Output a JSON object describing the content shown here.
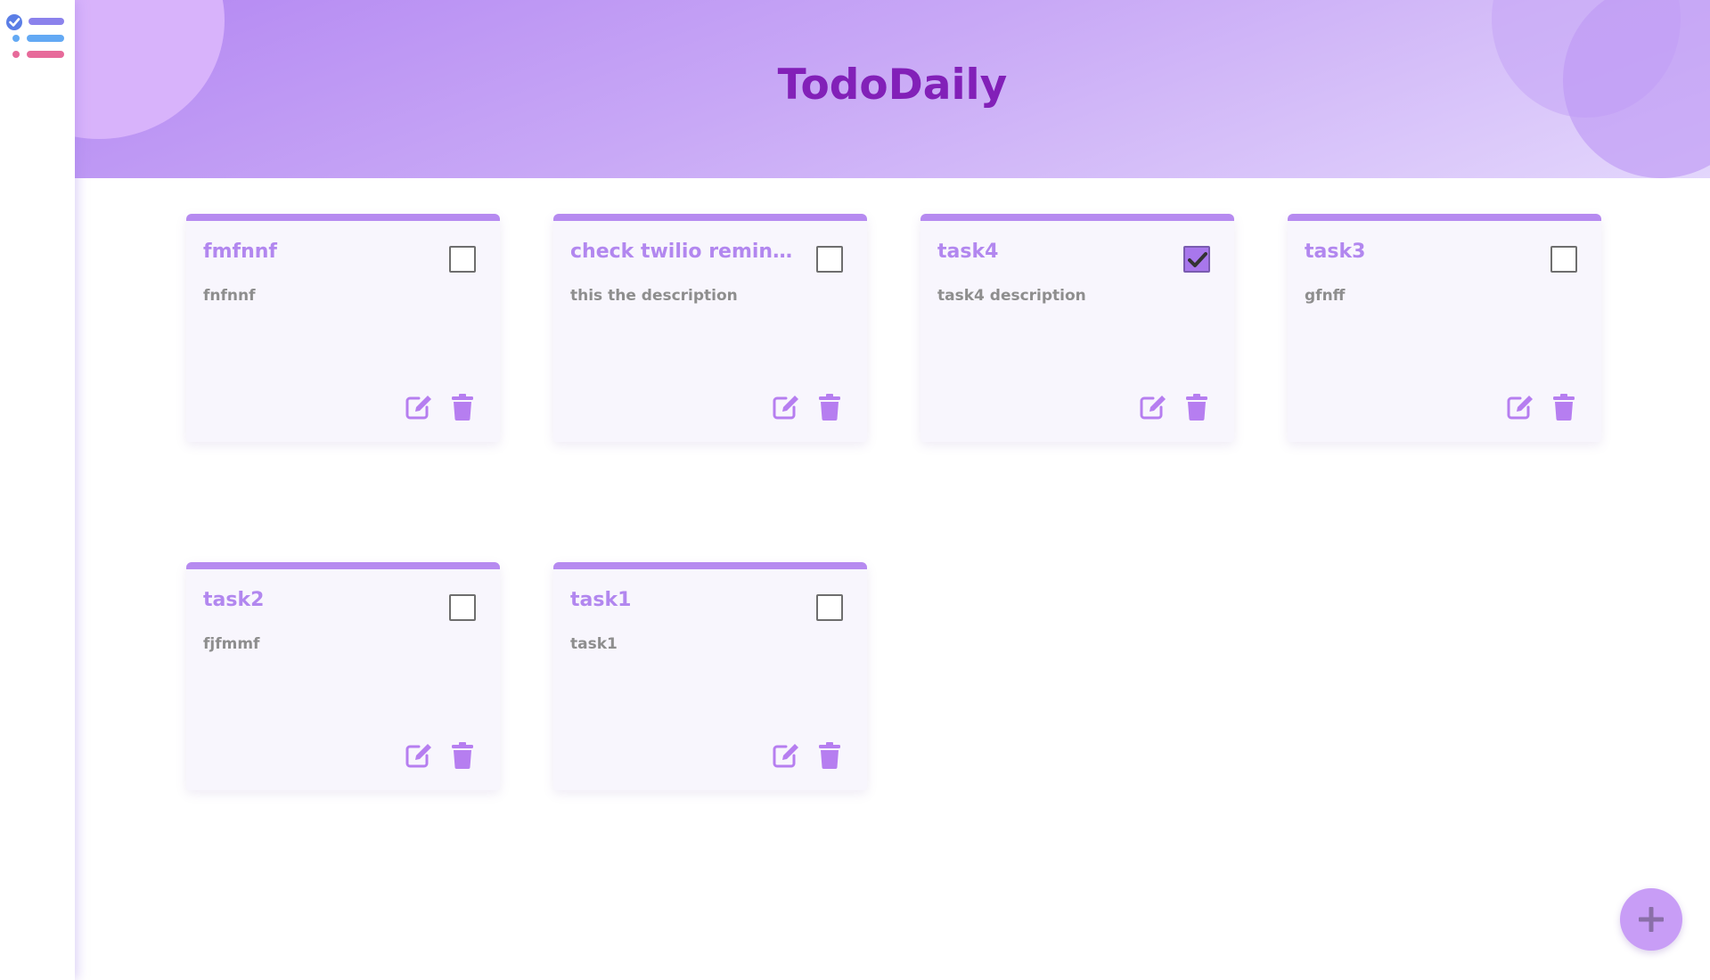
{
  "app": {
    "title": "TodoDaily",
    "logo_icon": "checklist-logo-icon",
    "accent_color": "#b68af0",
    "title_color": "#8220b8"
  },
  "tasks": [
    {
      "title": "fmfnnf",
      "description": "fnfnnf",
      "completed": false
    },
    {
      "title": "check twilio reminder",
      "description": "this the description",
      "completed": false
    },
    {
      "title": "task4",
      "description": "task4 description",
      "completed": true
    },
    {
      "title": "task3",
      "description": "gfnff",
      "completed": false
    },
    {
      "title": "task2",
      "description": "fjfmmf",
      "completed": false
    },
    {
      "title": "task1",
      "description": "task1",
      "completed": false
    }
  ],
  "card_actions": {
    "edit_icon": "edit-icon",
    "delete_icon": "trash-icon"
  },
  "fab": {
    "icon": "plus-icon"
  }
}
